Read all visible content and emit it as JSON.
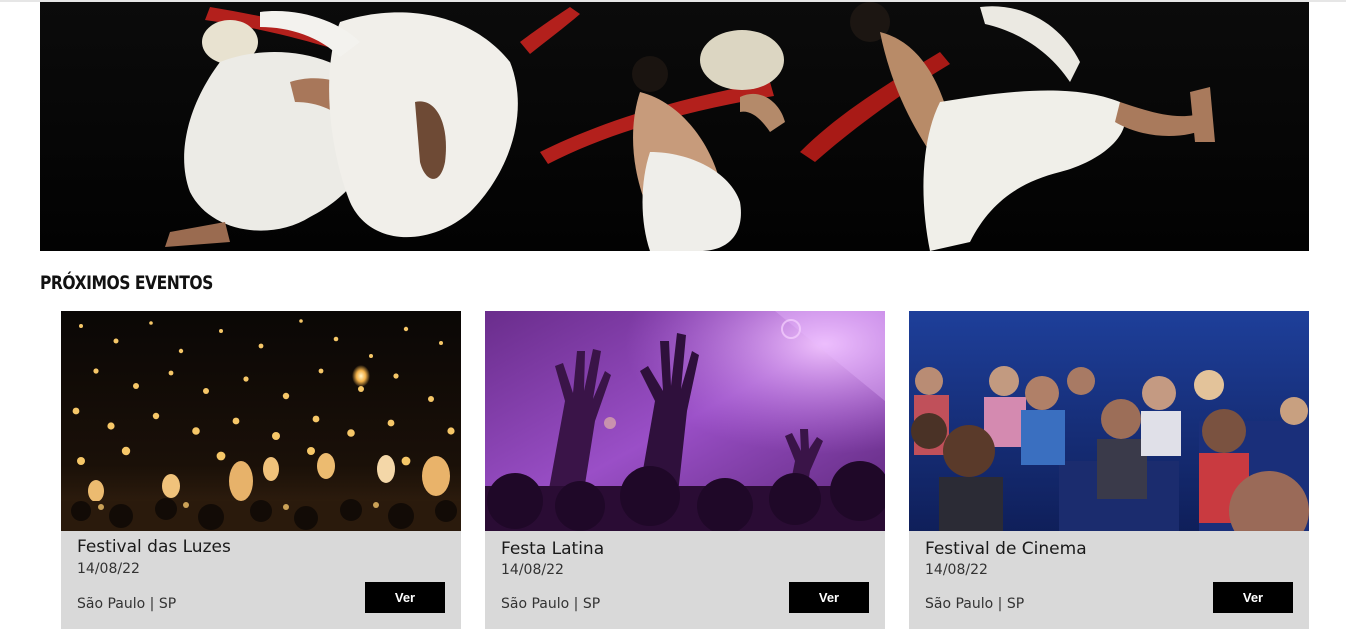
{
  "hero": {
    "image": "dancers-performance-photo"
  },
  "section": {
    "title": "PRÓXIMOS EVENTOS"
  },
  "events": [
    {
      "name": "Festival das Luzes",
      "date": "14/08/22",
      "location": "São Paulo | SP",
      "button": "Ver",
      "image": "sky-lanterns-photo"
    },
    {
      "name": "Festa Latina",
      "date": "14/08/22",
      "location": "São Paulo | SP",
      "button": "Ver",
      "image": "concert-crowd-photo"
    },
    {
      "name": "Festival de Cinema",
      "date": "14/08/22",
      "location": "São Paulo | SP",
      "button": "Ver",
      "image": "cinema-audience-photo"
    }
  ],
  "colors": {
    "card_bg": "#d9d9d9",
    "button_bg": "#000000",
    "button_text": "#ffffff"
  }
}
